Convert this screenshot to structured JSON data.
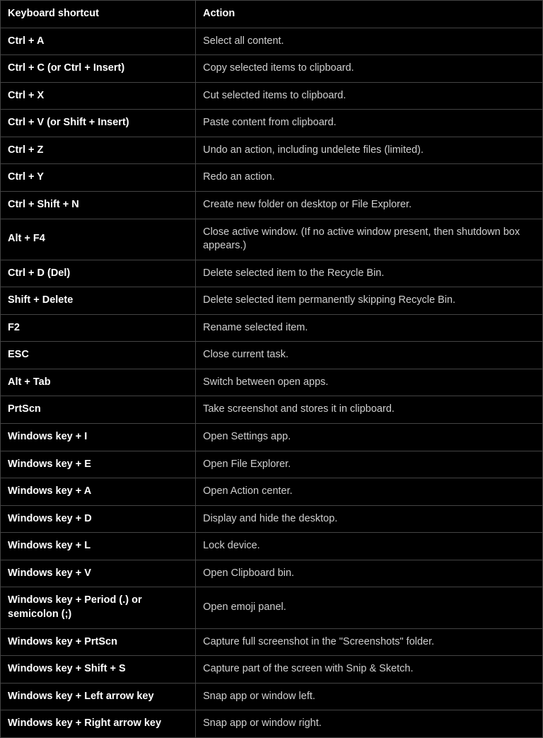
{
  "headers": {
    "shortcut": "Keyboard shortcut",
    "action": "Action"
  },
  "rows": [
    {
      "shortcut": "Ctrl + A",
      "action": "Select all content."
    },
    {
      "shortcut": "Ctrl + C (or Ctrl + Insert)",
      "action": "Copy selected items to clipboard."
    },
    {
      "shortcut": "Ctrl + X",
      "action": "Cut selected items to clipboard."
    },
    {
      "shortcut": "Ctrl + V (or Shift + Insert)",
      "action": "Paste content from clipboard."
    },
    {
      "shortcut": "Ctrl + Z",
      "action": "Undo an action, including undelete files (limited)."
    },
    {
      "shortcut": "Ctrl + Y",
      "action": "Redo an action."
    },
    {
      "shortcut": "Ctrl + Shift + N",
      "action": "Create new folder on desktop or File Explorer."
    },
    {
      "shortcut": "Alt + F4",
      "action": "Close active window. (If no active window present, then shutdown box appears.)"
    },
    {
      "shortcut": "Ctrl + D (Del)",
      "action": "Delete selected item to the Recycle Bin."
    },
    {
      "shortcut": "Shift + Delete",
      "action": "Delete selected item permanently skipping Recycle Bin."
    },
    {
      "shortcut": "F2",
      "action": "Rename selected item."
    },
    {
      "shortcut": "ESC",
      "action": "Close current task."
    },
    {
      "shortcut": "Alt + Tab",
      "action": "Switch between open apps."
    },
    {
      "shortcut": "PrtScn",
      "action": "Take screenshot and stores it in clipboard."
    },
    {
      "shortcut": "Windows key + I",
      "action": "Open Settings app."
    },
    {
      "shortcut": "Windows key + E",
      "action": "Open File Explorer."
    },
    {
      "shortcut": "Windows key + A",
      "action": "Open Action center."
    },
    {
      "shortcut": "Windows key + D",
      "action": "Display and hide the desktop."
    },
    {
      "shortcut": "Windows key + L",
      "action": "Lock device."
    },
    {
      "shortcut": "Windows key + V",
      "action": "Open Clipboard bin."
    },
    {
      "shortcut": "Windows key + Period (.) or semicolon (;)",
      "action": "Open emoji panel."
    },
    {
      "shortcut": "Windows key + PrtScn",
      "action": "Capture full screenshot in the \"Screenshots\" folder."
    },
    {
      "shortcut": "Windows key + Shift + S",
      "action": "Capture part of the screen with Snip & Sketch."
    },
    {
      "shortcut": "Windows key + Left arrow key",
      "action": "Snap app or window left."
    },
    {
      "shortcut": "Windows key + Right arrow key",
      "action": "Snap app or window right."
    }
  ]
}
